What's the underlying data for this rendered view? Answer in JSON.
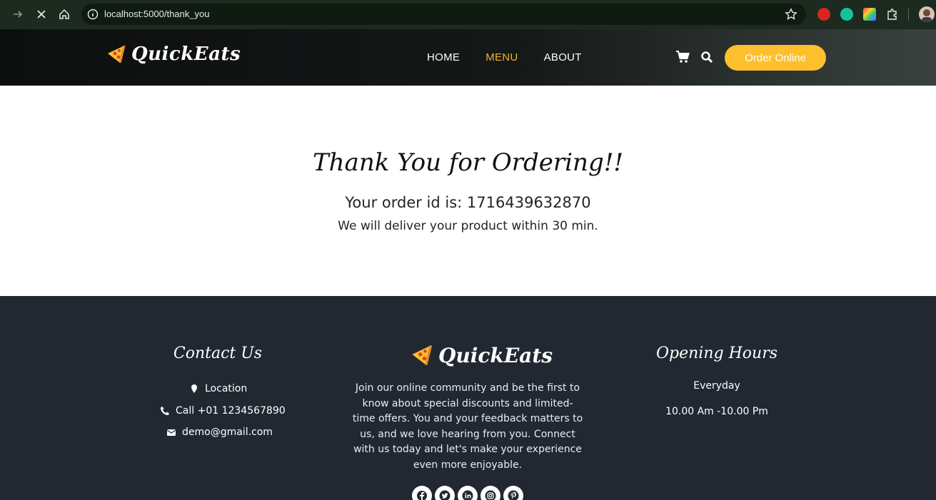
{
  "browser": {
    "url": "localhost:5000/thank_you",
    "icons": [
      "forward-icon",
      "stop-icon",
      "home-icon",
      "site-info-icon",
      "star-icon",
      "extension-icon",
      "grammarly-icon",
      "color-extension-icon",
      "puzzle-icon",
      "profile-avatar"
    ]
  },
  "header": {
    "brand": "QuickEats",
    "nav": [
      "HOME",
      "MENU",
      "ABOUT"
    ],
    "active_nav": "MENU",
    "order_button": "Order Online",
    "accent_color": "#fdbf2c"
  },
  "main": {
    "title": "Thank You for Ordering!!",
    "order_id_line": "Your order id is: 1716439632870",
    "delivery_line": "We will deliver your product within 30 min."
  },
  "footer": {
    "contact": {
      "title": "Contact Us",
      "location": "Location",
      "phone": "Call +01 1234567890",
      "email": "demo@gmail.com"
    },
    "brand": "QuickEats",
    "about": "Join our online community and be the first to know about special discounts and limited-time offers. You and your feedback matters to us, and we love hearing from you. Connect with us today and let's make your experience even more enjoyable.",
    "hours": {
      "title": "Opening Hours",
      "days": "Everyday",
      "time": "10.00 Am -10.00 Pm"
    },
    "socials": [
      "facebook-icon",
      "twitter-icon",
      "linkedin-icon",
      "instagram-icon",
      "pinterest-icon"
    ]
  }
}
